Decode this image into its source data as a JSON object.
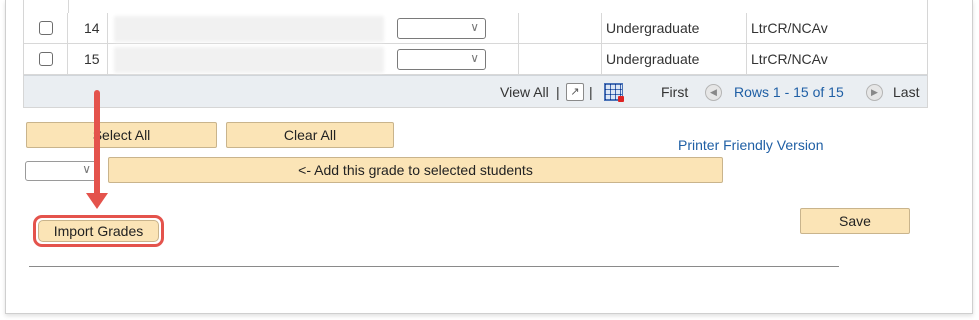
{
  "rows": [
    {
      "num": "14",
      "level": "Undergraduate",
      "basis": "LtrCR/NCAv"
    },
    {
      "num": "15",
      "level": "Undergraduate",
      "basis": "LtrCR/NCAv"
    }
  ],
  "grid_footer": {
    "view_all": "View All",
    "separator": "|",
    "first": "First",
    "rows_range": "Rows 1 - 15 of 15",
    "last": "Last"
  },
  "actions": {
    "select_all": "Select All",
    "clear_all": "Clear All",
    "printer_friendly": "Printer Friendly Version",
    "add_grade": "<- Add this grade to selected students",
    "import_grades": "Import Grades",
    "save": "Save"
  },
  "colors": {
    "button_bg": "#fbe4b6",
    "annotation": "#e4534c",
    "link": "#1f5fa5",
    "footer_bg": "#eaeef2"
  },
  "icons": {
    "zoom": "zoom-icon",
    "download": "download-grid-icon",
    "prev": "arrow-left-circle-icon",
    "next": "arrow-right-circle-icon",
    "dropdown": "chevron-down-icon"
  }
}
